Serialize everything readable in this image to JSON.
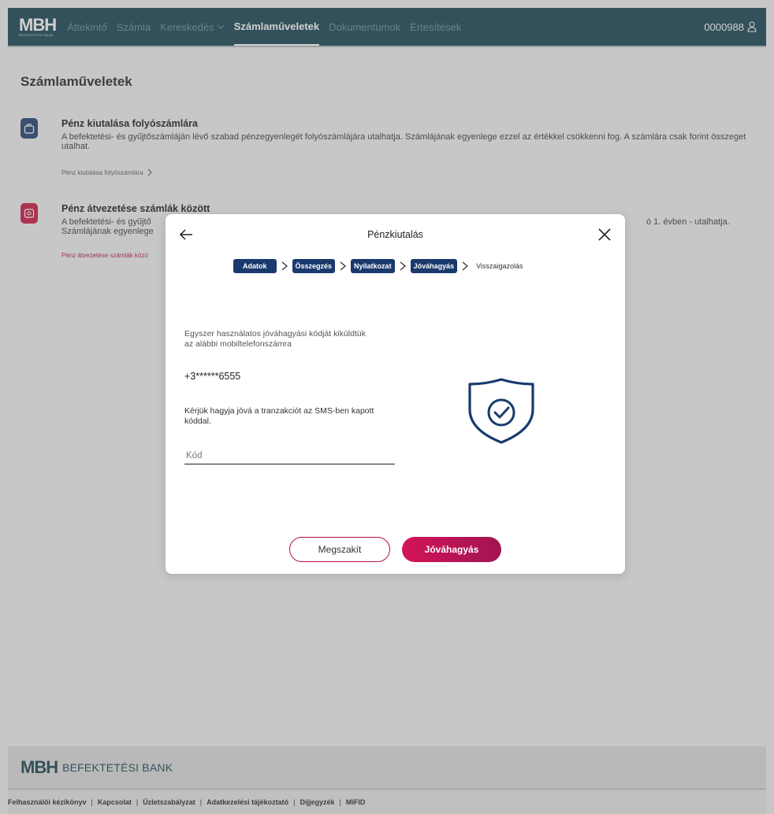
{
  "nav": {
    "logo": "MBH",
    "logo_sub": "BEFEKTETÉSI BANK",
    "items": [
      "Áttekintő",
      "Számla",
      "Kereskedés",
      "Számlaműveletek",
      "Dokumentumok",
      "Értesítések"
    ],
    "active_index": 3,
    "account_number": "0000988"
  },
  "page": {
    "title": "Számlaműveletek",
    "cards": [
      {
        "title": "Pénz kiutalása folyószámlára",
        "description": "A befektetési- és gyűjtőszámláján lévő szabad pénzegyenlegét folyószámlájára utalhatja. Számlájának egyenlege ezzel az értékkel csökkenni fog. A számlára csak forint összeget utalhat.",
        "link": "Pénz kiutalása folyószámlára"
      },
      {
        "title": "Pénz átvezetése számlák között",
        "description_left": "A befektetési- és gyűjtő",
        "description_left2": "Számlájának egyenlege",
        "description_right": "ó 1. évben - utalhatja.",
        "link": "Pénz átvezetése számlák közö"
      }
    ]
  },
  "modal": {
    "title": "Pénzkiutalás",
    "steps": [
      "Adatok",
      "Összegzés",
      "Nyilatkozat",
      "Jóváhagyás",
      "Visszaigazolás"
    ],
    "info_text": "Egyszer használatos jóváhagyási kódját kiküldtük az alábbi mobiltelefonszámra",
    "phone": "+3******6555",
    "approve_text": "Kérjük hagyja jóvá a tranzakciót az SMS-ben kapott kóddal.",
    "code_placeholder": "Kód",
    "cancel_label": "Megszakít",
    "approve_label": "Jóváhagyás"
  },
  "footer": {
    "brand_mark": "MBH",
    "brand_text": "BEFEKTETÉSI BANK",
    "links": [
      "Felhasználói kézikönyv",
      "Kapcsolat",
      "Üzletszabályzat",
      "Adatkezelési tájékoztató",
      "Díjjegyzék",
      "MiFID"
    ]
  },
  "colors": {
    "nav_bg": "#0f3d4a",
    "step_bg": "#1a3a6e",
    "accent": "#d4145a",
    "icon_blue": "#1a3a6e",
    "icon_red": "#c8103e"
  }
}
